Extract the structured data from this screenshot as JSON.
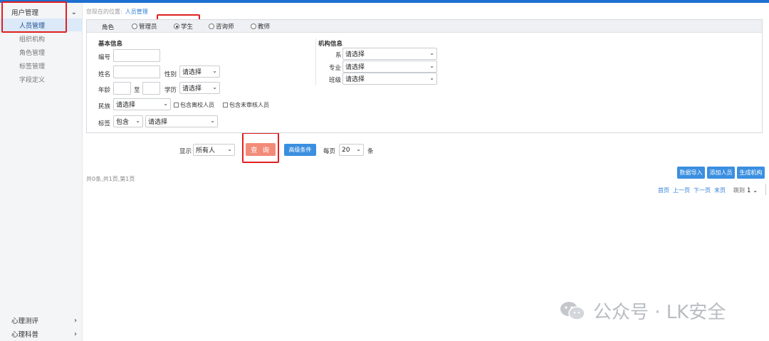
{
  "sidebar": {
    "group_user": "用户管理",
    "items": [
      "人员管理",
      "组织机构",
      "角色管理",
      "标签管理",
      "字段定义"
    ],
    "group_eval": "心理测评",
    "group_science": "心理科普"
  },
  "breadcrumb": {
    "prefix": "您现在的位置:",
    "current": "人员管理"
  },
  "roles": {
    "label": "角色",
    "options": [
      "管理员",
      "学生",
      "咨询师",
      "教师"
    ],
    "selected": "学生"
  },
  "basic": {
    "title": "基本信息",
    "id_label": "编号",
    "name_label": "姓名",
    "gender_label": "性别",
    "gender_value": "请选择",
    "age_label": "年龄",
    "age_to": "至",
    "edu_label": "学历",
    "edu_value": "请选择",
    "ethnic_label": "民族",
    "ethnic_value": "请选择",
    "chk_left_school": "包含离校人员",
    "chk_unapproved": "包含未审核人员",
    "tag_label": "标签",
    "tag_mode": "包含",
    "tag_value": "请选择"
  },
  "org": {
    "title": "机构信息",
    "dept_label": "系",
    "dept_value": "请选择",
    "major_label": "专业",
    "major_value": "请选择",
    "class_label": "班级",
    "class_value": "请选择"
  },
  "query": {
    "show_label": "显示",
    "show_value": "所有人",
    "query_button": "查 询",
    "advanced_button": "高级条件",
    "per_page_label": "每页",
    "per_page_value": "20",
    "per_page_unit": "条"
  },
  "actions": {
    "import": "数据导入",
    "add_person": "添加人员",
    "gen_org": "生成机构"
  },
  "results": {
    "summary": "共0条,共1页,第1页"
  },
  "pager": {
    "first": "首页",
    "prev": "上一页",
    "next": "下一页",
    "last": "末页",
    "jump_label": "跳到",
    "jump_value": "1"
  },
  "watermark": {
    "text": "公众号 · LK安全"
  },
  "colors": {
    "accent": "#1e6fd0",
    "query_button": "#f28b78",
    "blue_button": "#3b8fe0",
    "highlight_box": "#e02020"
  },
  "icons": {
    "expand": "chevron-down-icon",
    "collapsed": "chevron-right-icon",
    "select": "chevron-down-icon",
    "watermark": "wechat-icon"
  }
}
